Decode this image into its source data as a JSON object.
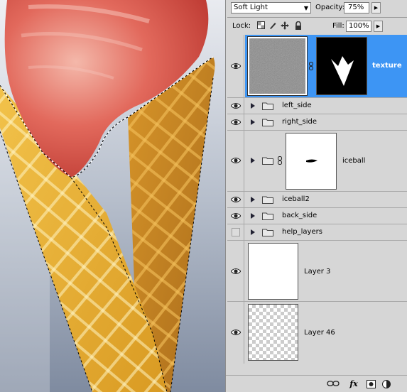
{
  "layers_panel": {
    "blend_mode": "Soft Light",
    "opacity_label": "Opacity:",
    "opacity_value": "75%",
    "lock_label": "Lock:",
    "fill_label": "Fill:",
    "fill_value": "100%",
    "lock_icons": [
      "lock-transparent-pixels-icon",
      "lock-image-pixels-icon",
      "lock-position-icon",
      "lock-all-icon"
    ],
    "layers": [
      {
        "name": "texture",
        "type": "layer-with-mask",
        "visible": true,
        "selected": true
      },
      {
        "name": "left_side",
        "type": "group",
        "visible": true
      },
      {
        "name": "right_side",
        "type": "group",
        "visible": true
      },
      {
        "name": "iceball",
        "type": "group-with-mask",
        "visible": true
      },
      {
        "name": "iceball2",
        "type": "group",
        "visible": true
      },
      {
        "name": "back_side",
        "type": "group",
        "visible": true
      },
      {
        "name": "help_layers",
        "type": "group",
        "visible": false
      },
      {
        "name": "Layer 3",
        "type": "layer",
        "visible": true
      },
      {
        "name": "Layer 46",
        "type": "layer",
        "visible": true
      }
    ],
    "bottom_icons": [
      "link-layers-icon",
      "layer-style-fx-icon",
      "add-mask-icon",
      "adjustment-layer-icon"
    ],
    "colors": {
      "selection": "#3d95f4",
      "panel": "#d6d6d6"
    }
  },
  "canvas": {
    "subject": "ice cream cone artwork",
    "colors": {
      "background": "#9aa6b8",
      "cone": "#e0a428",
      "ice_cream": "#d8584c"
    }
  }
}
